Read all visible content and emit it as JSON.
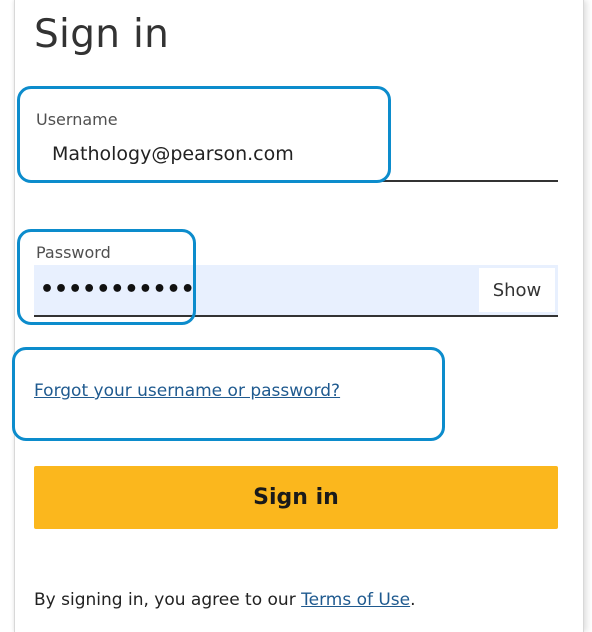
{
  "form": {
    "title": "Sign in",
    "username": {
      "label": "Username",
      "value": "Mathology@pearson.com"
    },
    "password": {
      "label": "Password",
      "masked_value": "•••••••••••",
      "show_label": "Show"
    },
    "forgot_link": "Forgot your username or password?",
    "submit_label": "Sign in",
    "terms": {
      "prefix": "By signing in, you agree to our ",
      "link": "Terms of Use",
      "suffix": "."
    }
  },
  "colors": {
    "accent_button": "#fbb71d",
    "link": "#1f5a8f",
    "password_autofill_bg": "#e8f0fe",
    "highlight_outline": "#0c8ccc"
  }
}
